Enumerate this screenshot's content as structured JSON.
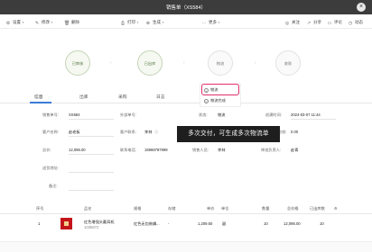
{
  "window": {
    "title": "销售单（XS584）"
  },
  "toolbar": {
    "left": [
      {
        "label": "设置",
        "icon": "gear-icon",
        "glyph": "⚙",
        "dropdown": true
      },
      {
        "label": "修改",
        "icon": "edit-icon",
        "glyph": "✎",
        "dropdown": true
      },
      {
        "label": "删除",
        "icon": "trash-icon",
        "glyph": "🗑",
        "dropdown": false
      },
      {
        "label": "打印",
        "icon": "printer-icon",
        "glyph": "⎙",
        "dropdown": true
      },
      {
        "label": "生成",
        "icon": "plus-circle-icon",
        "glyph": "⊕",
        "dropdown": true
      },
      {
        "label": "更多",
        "icon": "more-icon",
        "glyph": "⋯",
        "dropdown": true
      }
    ],
    "right": [
      {
        "label": "关注",
        "icon": "eye-icon",
        "glyph": "◎"
      },
      {
        "label": "分享",
        "icon": "share-icon",
        "glyph": "↗"
      },
      {
        "label": "评论",
        "icon": "comment-icon",
        "glyph": "▭"
      },
      {
        "label": "动态",
        "icon": "activity-icon",
        "glyph": "◷"
      }
    ]
  },
  "steps": {
    "items": [
      {
        "label": "已审核",
        "state": "done"
      },
      {
        "label": "已出库",
        "state": "done"
      },
      {
        "label": "物流",
        "state": "todo"
      },
      {
        "label": "收款",
        "state": "todo"
      }
    ],
    "colors": {
      "done_border": "#c4d4b8",
      "done_text": "#5c7a45",
      "todo_border": "#e2e2e2"
    }
  },
  "popmenu": {
    "items": [
      {
        "label": "物流",
        "icon": "logistics-icon",
        "glyph": "+"
      },
      {
        "label": "物流完成",
        "icon": "check-circle-icon",
        "glyph": "✓"
      }
    ],
    "highlight_color": "#e0306a"
  },
  "tabs": {
    "items": [
      "信息",
      "出库",
      "采购",
      "日志"
    ],
    "active": "信息",
    "accent": "#3a7bd5"
  },
  "form": {
    "row1": {
      "order_no_label": "销售单号:",
      "order_no": "XS584",
      "external_no_label": "外部单号:",
      "status_label": "状态:",
      "status": "物流",
      "created_label": "创建时间:",
      "created": "2024-03-07 11:44"
    },
    "row2": {
      "customer_label": "客户名称:",
      "customer": "赵老板",
      "contact_label": "客户联系:",
      "contact": "李林",
      "amount_label": "应收:",
      "amount": "0.00"
    },
    "row3": {
      "total_label": "总价:",
      "total": "12,096.00",
      "phone_label": "联系电话:",
      "phone": "15968787999",
      "owner_label": "销售人员:",
      "owner": "李林",
      "approver_label": "审批负责人:",
      "approver": "赵青"
    },
    "row4": {
      "address_label": "送货地址:"
    },
    "row5": {
      "remark_label": "备注:"
    }
  },
  "tooltip": {
    "text": "多次交付，可生成多次物流单"
  },
  "grid": {
    "headers": [
      "序号",
      "品名",
      "规格",
      "存储",
      "单价",
      "单位",
      "数量",
      "总价格",
      "已出库数"
    ],
    "rows": [
      {
        "index": "1",
        "name": "红色增强头戴耳机",
        "code": "1035672",
        "spec": "红色无包装耦...",
        "store": "-",
        "price": "1,209.60",
        "unit": "副",
        "qty": "10",
        "total": "12,096.00",
        "shipped": "10"
      }
    ]
  }
}
